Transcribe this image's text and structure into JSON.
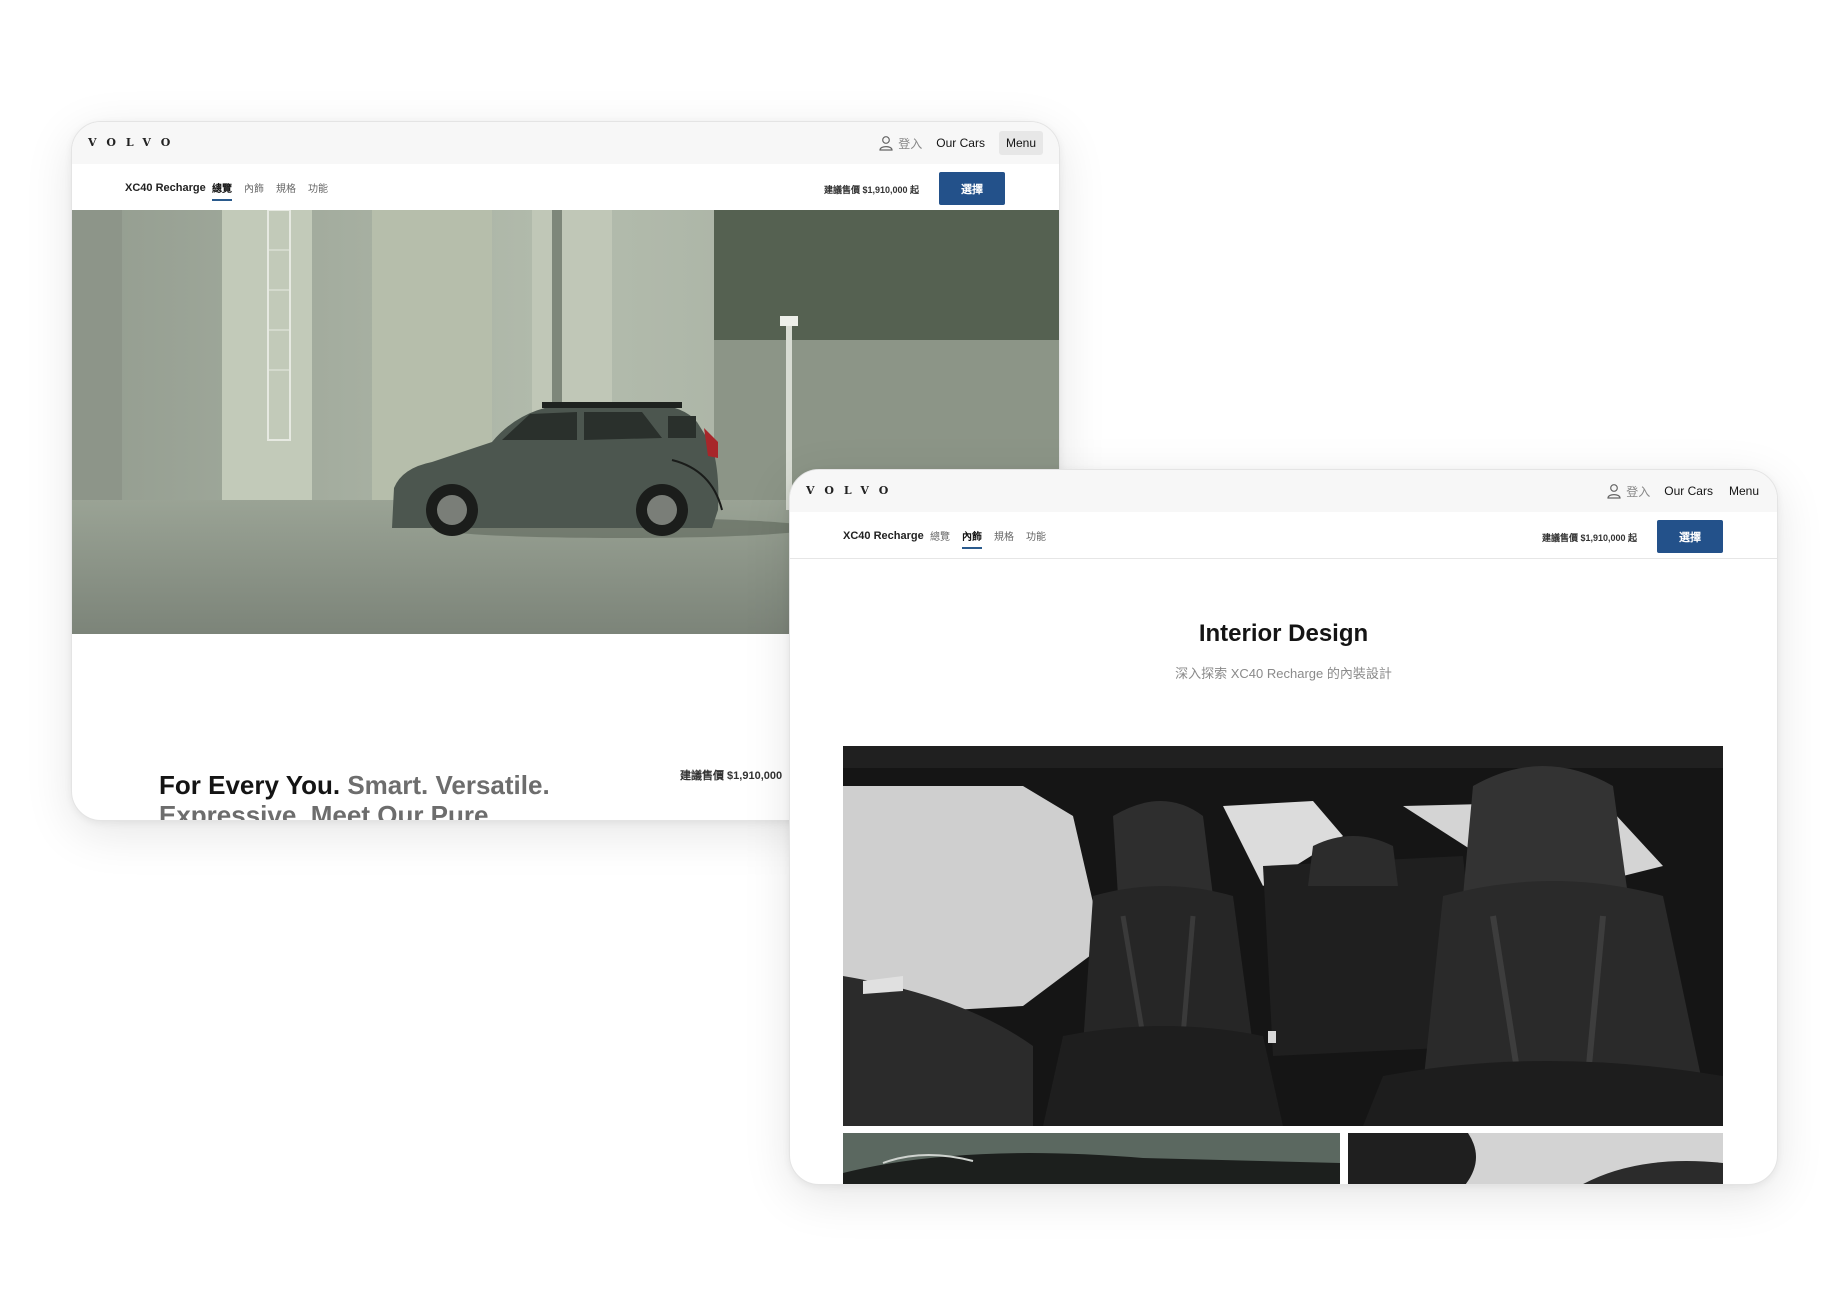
{
  "brand": {
    "logo_text": "VOLVO"
  },
  "header": {
    "login_label": "登入",
    "our_cars_label": "Our Cars",
    "menu_label": "Menu"
  },
  "subnav": {
    "model": "XC40 Recharge",
    "tabs": [
      "總覽",
      "內飾",
      "規格",
      "功能"
    ],
    "price_note": "建議售價 $1,910,000 起",
    "select_label": "選擇"
  },
  "window1": {
    "active_tab": "總覽",
    "headline_bold": "For Every You.",
    "headline_light": " Smart. Versatile. Expressive. Meet Our Pure",
    "price_teaser": "建議售價 $1,910,000"
  },
  "window2": {
    "active_tab": "內飾",
    "section_title": "Interior Design",
    "section_subtitle": "深入探索 XC40 Recharge 的內裝設計"
  },
  "colors": {
    "accent_blue": "#23518a",
    "hero_green": "#a3ac9e",
    "car_body": "#4c564f"
  },
  "icons": {
    "user": "user-icon"
  }
}
